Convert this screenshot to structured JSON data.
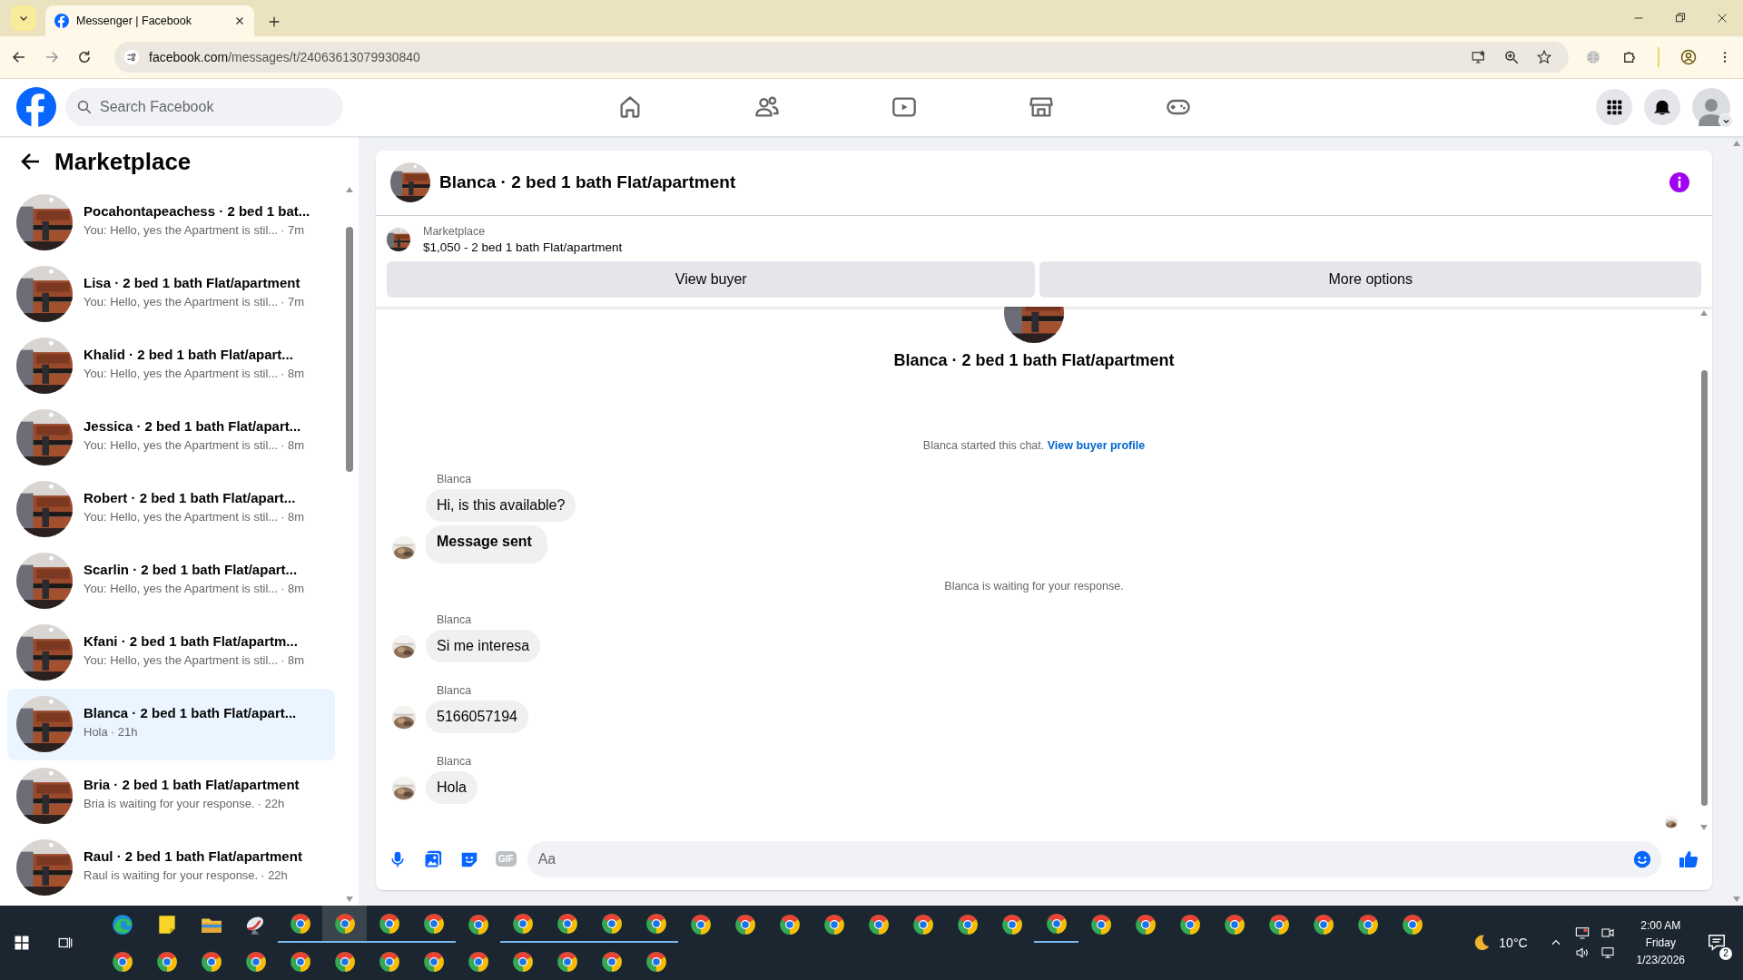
{
  "browser": {
    "tab_title": "Messenger | Facebook",
    "url_host": "facebook.com",
    "url_path": "/messages/t/24063613079930840"
  },
  "header": {
    "search_placeholder": "Search Facebook"
  },
  "sidebar": {
    "title": "Marketplace",
    "conversations": [
      {
        "title": "Pocahontapeachess · 2 bed 1 bat...",
        "preview": "You: Hello, yes the Apartment is stil...",
        "time": "· 7m",
        "selected": false
      },
      {
        "title": "Lisa · 2 bed 1 bath Flat/apartment",
        "preview": "You: Hello, yes the Apartment is stil...",
        "time": "· 7m",
        "selected": false
      },
      {
        "title": "Khalid · 2 bed 1 bath Flat/apart...",
        "preview": "You: Hello, yes the Apartment is stil...",
        "time": "· 8m",
        "selected": false
      },
      {
        "title": "Jessica · 2 bed 1 bath Flat/apart...",
        "preview": "You: Hello, yes the Apartment is stil...",
        "time": "· 8m",
        "selected": false
      },
      {
        "title": "Robert · 2 bed 1 bath Flat/apart...",
        "preview": "You: Hello, yes the Apartment is stil...",
        "time": "· 8m",
        "selected": false
      },
      {
        "title": "Scarlin · 2 bed 1 bath Flat/apart...",
        "preview": "You: Hello, yes the Apartment is stil...",
        "time": "· 8m",
        "selected": false
      },
      {
        "title": "Kfani · 2 bed 1 bath Flat/apartm...",
        "preview": "You: Hello, yes the Apartment is stil...",
        "time": "· 8m",
        "selected": false
      },
      {
        "title": "Blanca · 2 bed 1 bath Flat/apart...",
        "preview": "Hola",
        "time": "· 21h",
        "selected": true
      },
      {
        "title": "Bria · 2 bed 1 bath Flat/apartment",
        "preview": "Bria is waiting for your response.",
        "time": "· 22h",
        "selected": false
      },
      {
        "title": "Raul · 2 bed 1 bath Flat/apartment",
        "preview": "Raul is waiting for your response.",
        "time": "· 22h",
        "selected": false
      }
    ]
  },
  "chat": {
    "title": "Blanca · 2 bed 1 bath Flat/apartment",
    "listing": {
      "label": "Marketplace",
      "summary": "$1,050 - 2 bed 1 bath Flat/apartment"
    },
    "buttons": [
      "View buyer",
      "More options"
    ],
    "thread_title": "Blanca · 2 bed 1 bath Flat/apartment",
    "events": [
      {
        "kind": "notice",
        "text": "Blanca started this chat.",
        "link": "View buyer profile"
      },
      {
        "kind": "group",
        "sender": "Blanca",
        "messages": [
          {
            "kind": "text",
            "text": "Hi, is this available?"
          },
          {
            "kind": "status",
            "text": "Message sent"
          }
        ]
      },
      {
        "kind": "notice",
        "text": "Blanca is waiting for your response."
      },
      {
        "kind": "group",
        "sender": "Blanca",
        "messages": [
          {
            "kind": "text",
            "text": "Si me interesa"
          }
        ]
      },
      {
        "kind": "group",
        "sender": "Blanca",
        "messages": [
          {
            "kind": "text",
            "text": "5166057194"
          }
        ]
      },
      {
        "kind": "group",
        "sender": "Blanca",
        "messages": [
          {
            "kind": "text",
            "text": "Hola"
          }
        ]
      }
    ],
    "composer": {
      "placeholder": "Aa",
      "gif_label": "GIF"
    }
  },
  "taskbar": {
    "rows": [
      [
        {
          "kind": "edge",
          "running": false,
          "selected": false
        },
        {
          "kind": "notes",
          "running": false,
          "selected": false
        },
        {
          "kind": "folder",
          "running": false,
          "selected": false
        },
        {
          "kind": "app",
          "running": false,
          "selected": false
        },
        {
          "kind": "chrome",
          "running": true,
          "selected": false
        },
        {
          "kind": "chrome",
          "running": true,
          "selected": true
        },
        {
          "kind": "chrome",
          "running": true,
          "selected": false
        },
        {
          "kind": "chrome",
          "running": true,
          "selected": false
        },
        {
          "kind": "chrome",
          "running": false,
          "selected": false
        },
        {
          "kind": "chrome",
          "running": true,
          "selected": false
        },
        {
          "kind": "chrome",
          "running": true,
          "selected": false
        },
        {
          "kind": "chrome",
          "running": true,
          "selected": false
        },
        {
          "kind": "chrome",
          "running": true,
          "selected": false
        },
        {
          "kind": "chrome",
          "running": false,
          "selected": false
        },
        {
          "kind": "chrome",
          "running": false,
          "selected": false
        },
        {
          "kind": "chrome",
          "running": false,
          "selected": false
        },
        {
          "kind": "chrome",
          "running": false,
          "selected": false
        },
        {
          "kind": "chrome",
          "running": false,
          "selected": false
        },
        {
          "kind": "chrome",
          "running": false,
          "selected": false
        },
        {
          "kind": "chrome",
          "running": false,
          "selected": false
        },
        {
          "kind": "chrome",
          "running": false,
          "selected": false
        },
        {
          "kind": "chrome",
          "running": true,
          "selected": false
        },
        {
          "kind": "chrome",
          "running": false,
          "selected": false
        },
        {
          "kind": "chrome",
          "running": false,
          "selected": false
        },
        {
          "kind": "chrome",
          "running": false,
          "selected": false
        },
        {
          "kind": "chrome",
          "running": false,
          "selected": false
        },
        {
          "kind": "chrome",
          "running": false,
          "selected": false
        },
        {
          "kind": "chrome",
          "running": false,
          "selected": false
        },
        {
          "kind": "chrome",
          "running": false,
          "selected": false
        },
        {
          "kind": "chrome",
          "running": false,
          "selected": false
        }
      ],
      [
        {
          "kind": "chrome",
          "running": false,
          "selected": false
        },
        {
          "kind": "chrome",
          "running": false,
          "selected": false
        },
        {
          "kind": "chrome",
          "running": false,
          "selected": false
        },
        {
          "kind": "chrome",
          "running": false,
          "selected": false
        },
        {
          "kind": "chrome",
          "running": false,
          "selected": false
        },
        {
          "kind": "chrome",
          "running": false,
          "selected": false
        },
        {
          "kind": "chrome",
          "running": false,
          "selected": false
        },
        {
          "kind": "chrome",
          "running": false,
          "selected": false
        },
        {
          "kind": "chrome",
          "running": false,
          "selected": false
        },
        {
          "kind": "chrome",
          "running": false,
          "selected": false
        },
        {
          "kind": "chrome",
          "running": false,
          "selected": false
        },
        {
          "kind": "chrome",
          "running": false,
          "selected": false
        },
        {
          "kind": "chrome",
          "running": false,
          "selected": false
        }
      ]
    ],
    "weather": "10°C",
    "time": "2:00 AM",
    "day": "Friday",
    "date": "1/23/2026",
    "notifications": "2"
  }
}
